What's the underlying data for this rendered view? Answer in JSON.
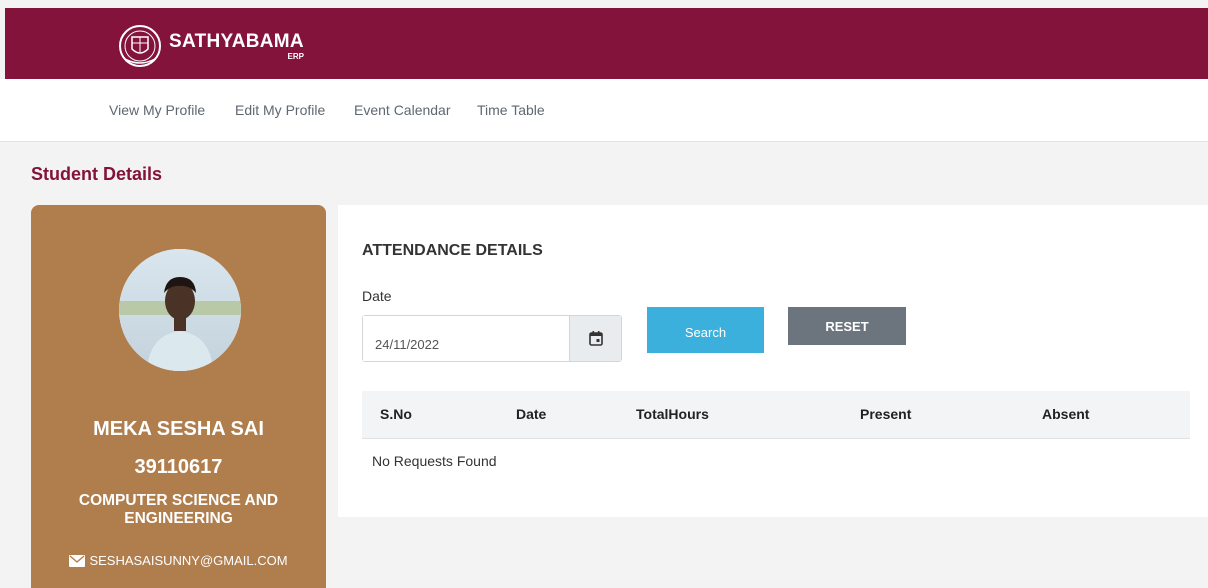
{
  "header": {
    "brand_name": "SATHYABAMA",
    "brand_sub": "ERP",
    "bg_color": "#84133b"
  },
  "nav": {
    "items": [
      {
        "label": "View My Profile"
      },
      {
        "label": "Edit My Profile"
      },
      {
        "label": "Event Calendar"
      },
      {
        "label": "Time Table"
      }
    ]
  },
  "page": {
    "section_title": "Student Details"
  },
  "profile": {
    "name": "MEKA SESHA SAI",
    "id": "39110617",
    "department": "COMPUTER SCIENCE AND ENGINEERING",
    "email": "SESHASAISUNNY@GMAIL.COM",
    "card_color": "#b07d4d"
  },
  "attendance": {
    "title": "ATTENDANCE DETAILS",
    "date_label": "Date",
    "date_value": "24/11/2022",
    "search_label": "Search",
    "reset_label": "RESET",
    "columns": [
      "S.No",
      "Date",
      "TotalHours",
      "Present",
      "Absent"
    ],
    "empty_message": "No Requests Found"
  }
}
